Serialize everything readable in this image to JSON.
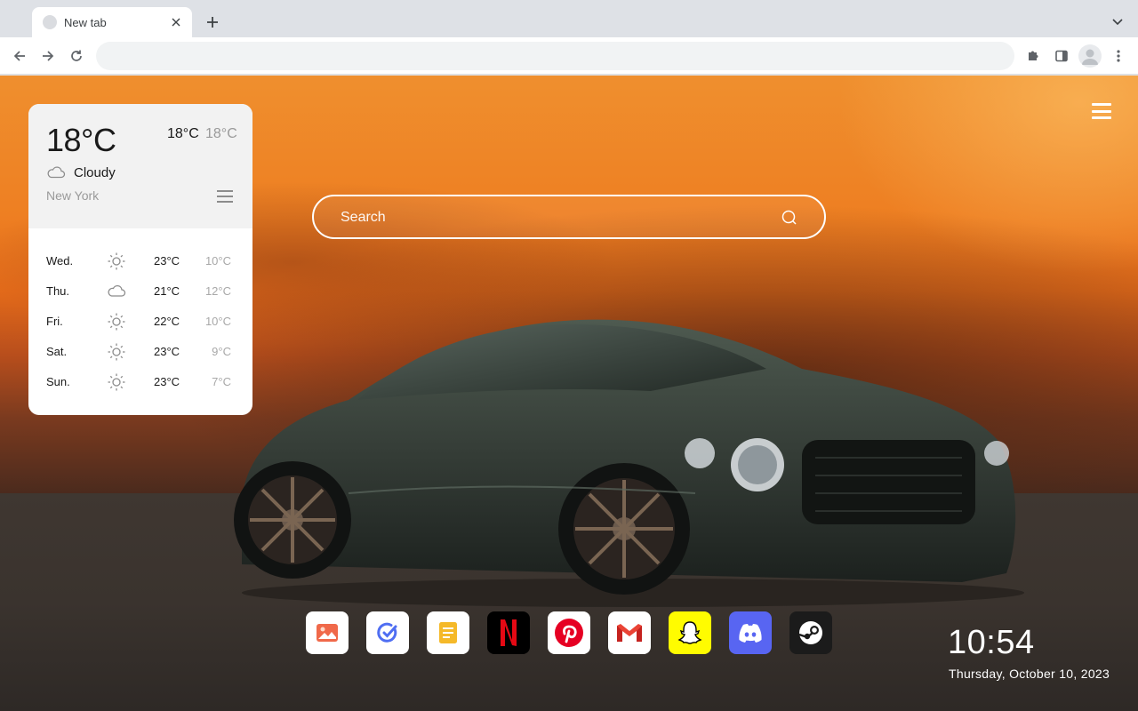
{
  "browser": {
    "tab": {
      "title": "New tab"
    },
    "omnibox": {
      "value": "",
      "placeholder": ""
    }
  },
  "weather": {
    "current_temp": "18°C",
    "high": "18°C",
    "low": "18°C",
    "condition": "Cloudy",
    "city": "New York",
    "forecast": [
      {
        "day": "Wed.",
        "icon": "sun-icon",
        "high": "23°C",
        "low": "10°C"
      },
      {
        "day": "Thu.",
        "icon": "cloud-icon",
        "high": "21°C",
        "low": "12°C"
      },
      {
        "day": "Fri.",
        "icon": "sun-icon",
        "high": "22°C",
        "low": "10°C"
      },
      {
        "day": "Sat.",
        "icon": "sun-icon",
        "high": "23°C",
        "low": "9°C"
      },
      {
        "day": "Sun.",
        "icon": "sun-icon",
        "high": "23°C",
        "low": "7°C"
      }
    ]
  },
  "search": {
    "placeholder": "Search"
  },
  "dock": {
    "apps": [
      {
        "name": "wallpaper-app",
        "icon": "picture-icon",
        "color": "#f0694a"
      },
      {
        "name": "tasks-app",
        "icon": "check-circle-icon",
        "color": "#4f6ef2"
      },
      {
        "name": "notes-app",
        "icon": "note-icon",
        "color": "#f5b929"
      },
      {
        "name": "netflix-app",
        "icon": "netflix-icon",
        "color": "#e50914"
      },
      {
        "name": "pinterest-app",
        "icon": "pinterest-icon",
        "color": "#e60023"
      },
      {
        "name": "gmail-app",
        "icon": "gmail-icon",
        "color": "#ea4335"
      },
      {
        "name": "snapchat-app",
        "icon": "ghost-icon",
        "color": "#fffc00"
      },
      {
        "name": "discord-app",
        "icon": "discord-icon",
        "color": "#5865f2"
      },
      {
        "name": "steam-app",
        "icon": "steam-icon",
        "color": "#171a21"
      }
    ]
  },
  "clock": {
    "time": "10:54",
    "date": "Thursday, October 10, 2023"
  }
}
